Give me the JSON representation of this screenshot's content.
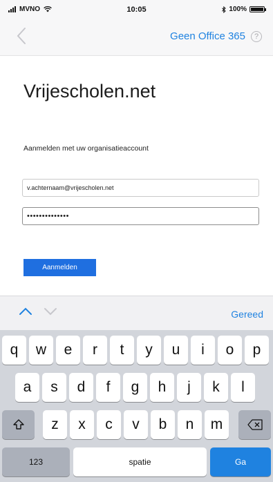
{
  "status_bar": {
    "carrier": "MVNO",
    "time": "10:05",
    "battery": "100%",
    "battery_level": 1.0
  },
  "nav": {
    "link_label": "Geen Office 365",
    "help_glyph": "?",
    "back_icon": "chevron-left-icon"
  },
  "page": {
    "title": "Vrijescholen.net",
    "subtitle": "Aanmelden met uw organisatieaccount",
    "email_value": "v.achternaam@vrijescholen.net",
    "password_value": "••••••••••••••",
    "submit_label": "Aanmelden"
  },
  "keyboard_bar": {
    "done_label": "Gereed",
    "up_icon": "chevron-up-icon",
    "down_icon": "chevron-down-icon"
  },
  "keyboard": {
    "row1": [
      "q",
      "w",
      "e",
      "r",
      "t",
      "y",
      "u",
      "i",
      "o",
      "p"
    ],
    "row2": [
      "a",
      "s",
      "d",
      "f",
      "g",
      "h",
      "j",
      "k",
      "l"
    ],
    "row3": [
      "z",
      "x",
      "c",
      "v",
      "b",
      "n",
      "m"
    ],
    "numbers_label": "123",
    "space_label": "spatie",
    "go_label": "Ga"
  },
  "colors": {
    "accent": "#1f82e0",
    "button": "#1f6fe0",
    "keyboard_bg": "#d2d5db"
  }
}
